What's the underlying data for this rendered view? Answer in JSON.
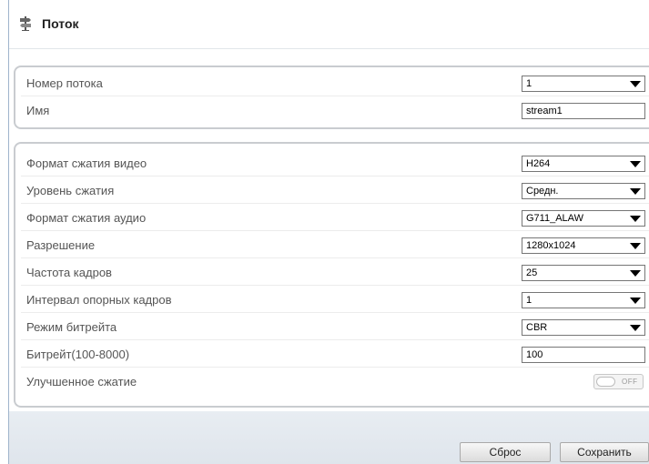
{
  "header": {
    "title": "Поток",
    "icon": "signpost-icon"
  },
  "stream_group": {
    "rows": [
      {
        "label": "Номер потока",
        "type": "select",
        "value": "1"
      },
      {
        "label": "Имя",
        "type": "input",
        "value": "stream1"
      }
    ]
  },
  "settings_group": {
    "rows": [
      {
        "label": "Формат сжатия видео",
        "type": "select",
        "value": "H264"
      },
      {
        "label": "Уровень сжатия",
        "type": "select",
        "value": "Средн."
      },
      {
        "label": "Формат сжатия аудио",
        "type": "select",
        "value": "G711_ALAW"
      },
      {
        "label": "Разрешение",
        "type": "select",
        "value": "1280x1024"
      },
      {
        "label": "Частота кадров",
        "type": "select",
        "value": "25"
      },
      {
        "label": "Интервал опорных кадров",
        "type": "select",
        "value": "1"
      },
      {
        "label": "Режим битрейта",
        "type": "select",
        "value": "CBR"
      },
      {
        "label": "Битрейт(100-8000)",
        "type": "input",
        "value": "100"
      },
      {
        "label": "Улучшенное сжатие",
        "type": "toggle",
        "value": "OFF"
      }
    ]
  },
  "buttons": {
    "reset": "Сброс",
    "save": "Сохранить"
  }
}
